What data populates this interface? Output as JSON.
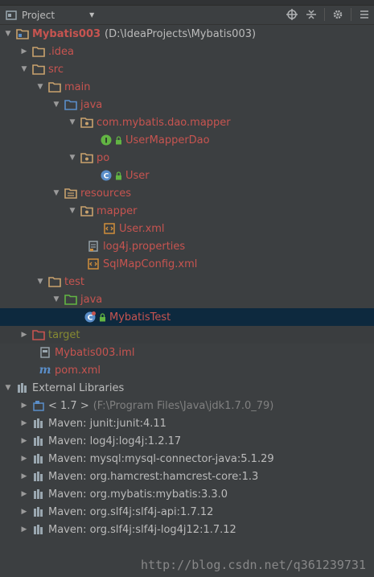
{
  "header": {
    "title": "Project"
  },
  "tree": {
    "root": {
      "name": "Mybatis003",
      "path": "(D:\\IdeaProjects\\Mybatis003)"
    },
    "idea": ".idea",
    "src": "src",
    "main": "main",
    "java": "java",
    "pkg_mapper": "com.mybatis.dao.mapper",
    "usermapperdao": "UserMapperDao",
    "po": "po",
    "user_class": "User",
    "resources": "resources",
    "mapper": "mapper",
    "user_xml": "User.xml",
    "log4j": "log4j.properties",
    "sqlmap": "SqlMapConfig.xml",
    "test": "test",
    "test_java": "java",
    "mybatistest": "MybatisTest",
    "target": "target",
    "iml": "Mybatis003.iml",
    "pom": "pom.xml",
    "external": "External Libraries",
    "jdk": {
      "name": "< 1.7 >",
      "path": "(F:\\Program Files\\Java\\jdk1.7.0_79)"
    },
    "libs": [
      "Maven: junit:junit:4.11",
      "Maven: log4j:log4j:1.2.17",
      "Maven: mysql:mysql-connector-java:5.1.29",
      "Maven: org.hamcrest:hamcrest-core:1.3",
      "Maven: org.mybatis:mybatis:3.3.0",
      "Maven: org.slf4j:slf4j-api:1.7.12",
      "Maven: org.slf4j:slf4j-log4j12:1.7.12"
    ]
  },
  "watermark": "http://blog.csdn.net/q361239731",
  "colors": {
    "background": "#3c3f41",
    "selected_row": "#0d293e",
    "modified_red": "#c75450",
    "target_olive": "#868a32",
    "folder_tan": "#c9a26d",
    "source_blue": "#5a8ec9",
    "test_green": "#62b543"
  }
}
